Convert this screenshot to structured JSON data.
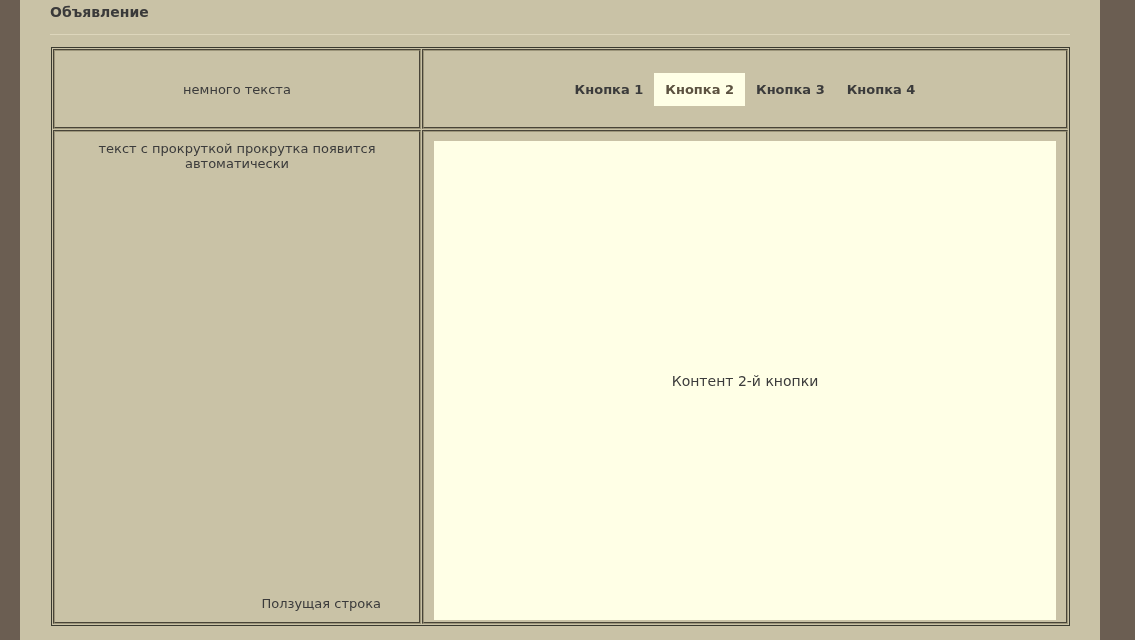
{
  "title": "Объявление",
  "header_text": "немного текста",
  "sidebar_text": "текст с прокруткой прокрутка появится автоматически",
  "marquee_text": "Ползущая строка",
  "tabs": [
    {
      "label": "Кнопка 1",
      "selected": false
    },
    {
      "label": "Кнопка 2",
      "selected": true
    },
    {
      "label": "Кнопка 3",
      "selected": false
    },
    {
      "label": "Кнопка 4",
      "selected": false
    }
  ],
  "content_text": "Контент 2-й кнопки"
}
